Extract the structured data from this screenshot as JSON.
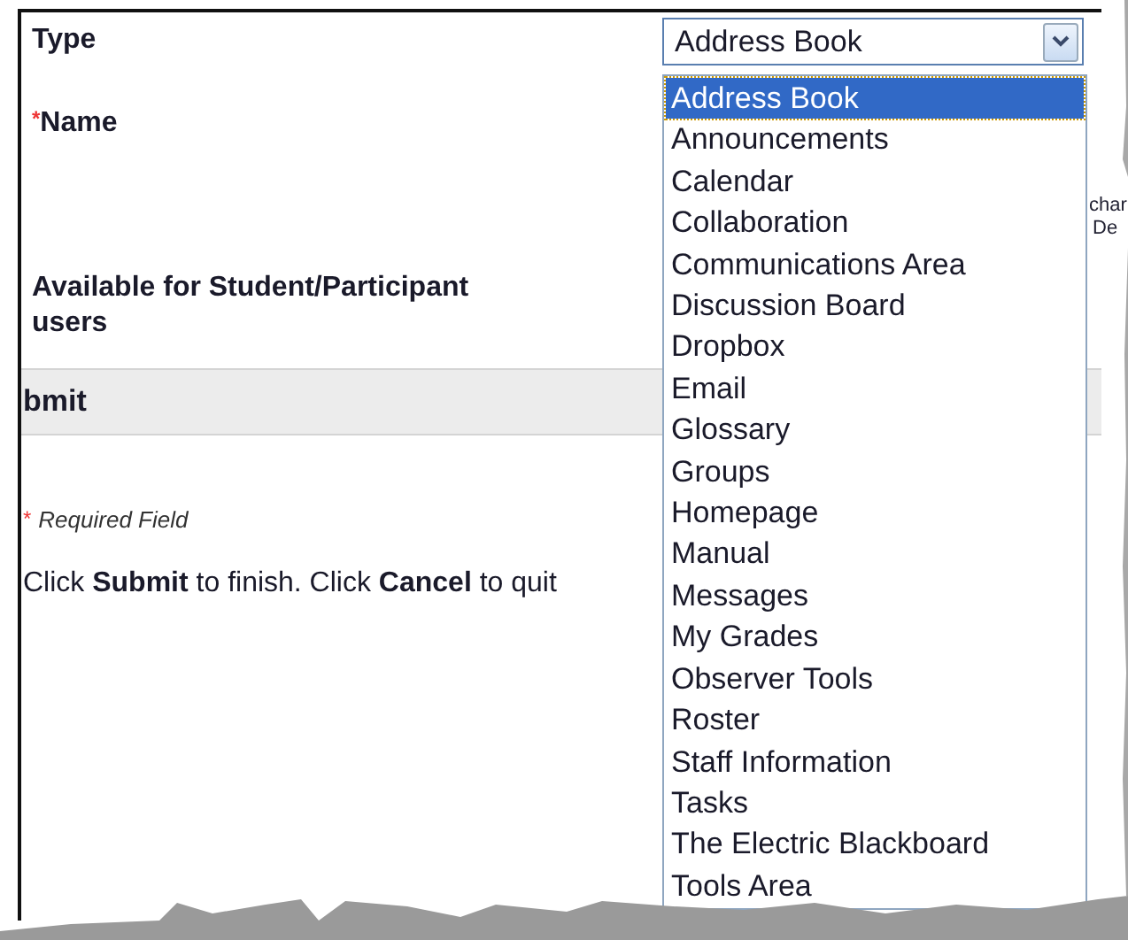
{
  "form": {
    "type_label": "Type",
    "required_mark": "*",
    "name_label": "Name",
    "availability_label": "Available for Student/Participant users"
  },
  "submit_bar": {
    "title": "bmit"
  },
  "footer": {
    "required_mark": "*",
    "required_note": "Required Field",
    "instructions": "Click **Submit** to finish. Click **Cancel** to quit"
  },
  "side_fragments": [
    "char",
    "De"
  ],
  "type_select": {
    "value": "Address Book",
    "expanded": true,
    "options": [
      {
        "label": "Address Book",
        "selected": true
      },
      {
        "label": "Announcements",
        "selected": false
      },
      {
        "label": "Calendar",
        "selected": false
      },
      {
        "label": "Collaboration",
        "selected": false
      },
      {
        "label": "Communications Area",
        "selected": false
      },
      {
        "label": "Discussion Board",
        "selected": false
      },
      {
        "label": "Dropbox",
        "selected": false
      },
      {
        "label": "Email",
        "selected": false
      },
      {
        "label": "Glossary",
        "selected": false
      },
      {
        "label": "Groups",
        "selected": false
      },
      {
        "label": "Homepage",
        "selected": false
      },
      {
        "label": "Manual",
        "selected": false
      },
      {
        "label": "Messages",
        "selected": false
      },
      {
        "label": "My Grades",
        "selected": false
      },
      {
        "label": "Observer Tools",
        "selected": false
      },
      {
        "label": "Roster",
        "selected": false
      },
      {
        "label": "Staff Information",
        "selected": false
      },
      {
        "label": "Tasks",
        "selected": false
      },
      {
        "label": "The Electric Blackboard",
        "selected": false
      },
      {
        "label": "Tools Area",
        "selected": false
      }
    ]
  }
}
